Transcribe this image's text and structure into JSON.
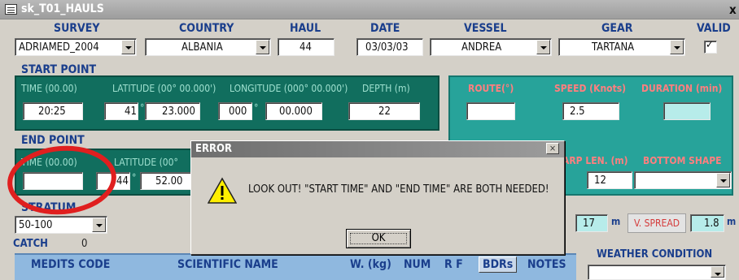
{
  "window": {
    "title": "sk_T01_HAULS",
    "close": "x"
  },
  "header": {
    "survey": {
      "label": "SURVEY",
      "value": "ADRIAMED_2004"
    },
    "country": {
      "label": "COUNTRY",
      "value": "ALBANIA"
    },
    "haul": {
      "label": "HAUL",
      "value": "44"
    },
    "date": {
      "label": "DATE",
      "value": "03/03/03"
    },
    "vessel": {
      "label": "VESSEL",
      "value": "ANDREA"
    },
    "gear": {
      "label": "GEAR",
      "value": "TARTANA"
    },
    "valid": {
      "label": "VALID",
      "checked": "✓"
    }
  },
  "start_point": {
    "title": "START POINT",
    "time_label": "TIME (00.00)",
    "lat_label": "LATITUDE (00° 00.000')",
    "lon_label": "LONGITUDE (000° 00.000')",
    "depth_label": "DEPTH (m)",
    "time": "20:25",
    "lat_deg": "41",
    "lat_min": "23.000",
    "lon_deg": "000",
    "lon_min": "00.000",
    "depth": "22"
  },
  "route_panel": {
    "route_label": "ROUTE(°)",
    "speed_label": "SPEED (Knots)",
    "duration_label": "DURATION (min)",
    "route": "",
    "speed": "2.5",
    "duration": "",
    "warp_label": "ARP LEN. (m)",
    "bottom_label": "BOTTOM SHAPE",
    "warp": "12",
    "bottom": ""
  },
  "end_point": {
    "title": "END POINT",
    "time_label": "TIME (00.00)",
    "lat_label": "LATITUDE (00°",
    "time": "",
    "lat_deg": "44",
    "lat_min": "52.00"
  },
  "stratum": {
    "title": "STRATUM",
    "value": "50-100"
  },
  "spread": {
    "h_value": "17",
    "h_unit": "m",
    "v_label": "V. SPREAD",
    "v_value": "1.8",
    "v_unit": "m"
  },
  "catch": {
    "label": "CATCH",
    "value": "0",
    "columns": [
      "MEDITS CODE",
      "SCIENTIFIC NAME",
      "W. (kg)",
      "NUM",
      "R F",
      "BDRs",
      "NOTES"
    ]
  },
  "weather": {
    "label": "WEATHER CONDITION",
    "value": ""
  },
  "dialog": {
    "title": "ERROR",
    "message": "LOOK OUT! \"START TIME\" AND \"END TIME\" ARE BOTH NEEDED!",
    "ok": "OK",
    "close": "×"
  },
  "colors": {
    "highlight_circle": "#e01f1f",
    "dialog_title": "#777777"
  }
}
